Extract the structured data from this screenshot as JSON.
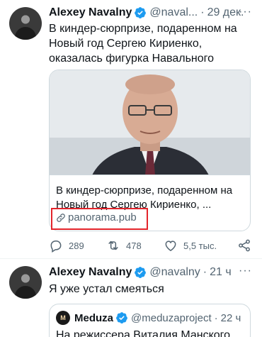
{
  "tweets": [
    {
      "name": "Alexey Navalny",
      "handle": "@naval...",
      "dot": "·",
      "time": "29 дек.",
      "more": "···",
      "text": "В киндер-сюрпризе, подаренном на Новый год Сергею Кириенко, оказалась фигурка Навального",
      "card": {
        "title": "В киндер-сюрпризе, подаренном на Новый год Сергею Кириенко, ...",
        "domain": "panorama.pub"
      },
      "actions": {
        "reply_count": "289",
        "retweet_count": "478",
        "like_count": "5,5 тыс."
      }
    },
    {
      "name": "Alexey Navalny",
      "handle": "@navalny",
      "dot": "·",
      "time": "21 ч",
      "more": "···",
      "text": "Я уже устал смеяться",
      "quote": {
        "avatar_text": "M",
        "name": "Meduza",
        "handle": "@meduzaproject",
        "dot": "·",
        "time": "22 ч",
        "text": "На режиссера Виталия Манского"
      }
    }
  ],
  "colors": {
    "verified": "#1d9bf0",
    "muted": "#536471",
    "highlight": "#e3242b"
  },
  "icons": [
    "verified-badge-icon",
    "more-icon",
    "link-icon",
    "reply-icon",
    "retweet-icon",
    "like-icon",
    "share-icon"
  ]
}
